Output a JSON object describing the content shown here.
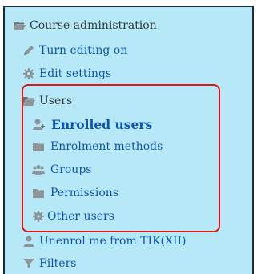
{
  "menu": {
    "header": {
      "label": "Course administration",
      "icon": "folder-open-icon"
    },
    "items": [
      {
        "label": "Turn editing on",
        "icon": "pencil-icon"
      },
      {
        "label": "Edit settings",
        "icon": "gear-icon"
      }
    ],
    "users_group": {
      "label": "Users",
      "icon": "folder-open-icon",
      "children": [
        {
          "label": "Enrolled users",
          "icon": "user-plus-icon",
          "active": true
        },
        {
          "label": "Enrolment methods",
          "icon": "folder-icon"
        },
        {
          "label": "Groups",
          "icon": "group-icon"
        },
        {
          "label": "Permissions",
          "icon": "folder-icon"
        },
        {
          "label": "Other users",
          "icon": "cog-icon"
        }
      ]
    },
    "after_items": [
      {
        "label": "Unenrol me from TIK(XII)",
        "icon": "user-icon"
      },
      {
        "label": "Filters",
        "icon": "filter-icon"
      }
    ]
  },
  "colors": {
    "panel_bg": "#b6e8f8",
    "link": "#0e56b3",
    "text_dark": "#333a40",
    "icon_gray": "#8d9599",
    "highlight": "#e01616"
  }
}
